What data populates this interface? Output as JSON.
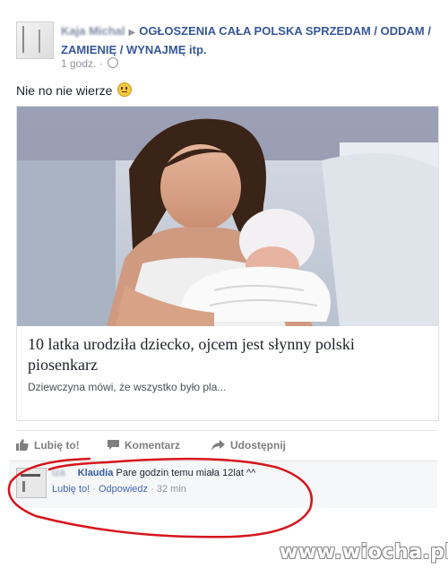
{
  "post": {
    "author_blurred": "Kaja Michal",
    "group": "OGŁOSZENIA CAŁA POLSKA SPRZEDAM / ODDAM / ZAMIENIĘ / WYNAJMĘ itp.",
    "time": "1 godz.",
    "text": "Nie no nie wierze"
  },
  "link_card": {
    "title": "10 latka urodziła dziecko, ojcem jest słynny polski piosenkarz",
    "description": "Dziewczyna mówi, że wszystko było pla..."
  },
  "actions": {
    "like": "Lubię to!",
    "comment": "Komentarz",
    "share": "Udostępnij"
  },
  "comment": {
    "name_blurred": "Iza",
    "name": "Klaudia",
    "text": "Pare godzin temu miała 12lat ^^",
    "like": "Lubię to!",
    "separator": "·",
    "reply": "Odpowiedz",
    "time": "32 min"
  },
  "watermark": "www.wiocha.pl",
  "colors": {
    "link_blue": "#365899",
    "annotation_red": "#d6151c"
  }
}
